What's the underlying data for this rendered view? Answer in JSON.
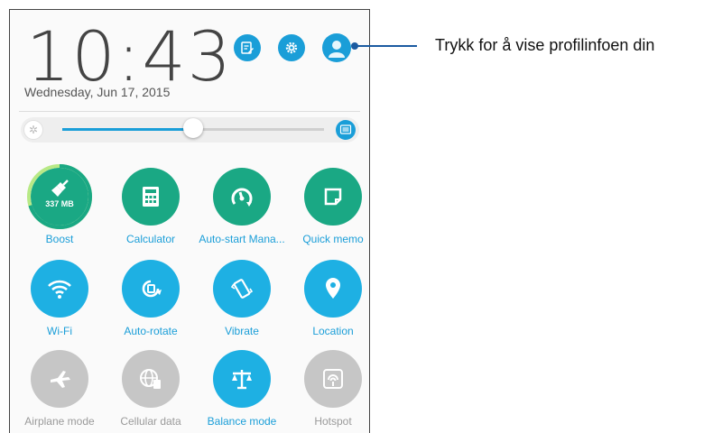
{
  "lockscreen": {
    "time": "10:43",
    "date": "Wednesday, Jun 17, 2015"
  },
  "header_icons": [
    {
      "name": "edit-icon"
    },
    {
      "name": "settings-icon"
    },
    {
      "name": "profile-icon"
    }
  ],
  "brightness": {
    "level_percent": 50,
    "auto_label": "AUTO"
  },
  "tiles": [
    {
      "label": "Boost",
      "sub": "337 MB",
      "state": "on",
      "color": "#1aa884"
    },
    {
      "label": "Calculator",
      "state": "on",
      "color": "#1aa884"
    },
    {
      "label": "Auto-start Mana...",
      "state": "on",
      "color": "#1aa884"
    },
    {
      "label": "Quick memo",
      "state": "on",
      "color": "#1aa884"
    },
    {
      "label": "Wi-Fi",
      "state": "on",
      "color": "#1eb0e3"
    },
    {
      "label": "Auto-rotate",
      "state": "on",
      "color": "#1eb0e3"
    },
    {
      "label": "Vibrate",
      "state": "on",
      "color": "#1eb0e3"
    },
    {
      "label": "Location",
      "state": "on",
      "color": "#1eb0e3"
    },
    {
      "label": "Airplane mode",
      "state": "off",
      "color": "#c6c6c6"
    },
    {
      "label": "Cellular data",
      "state": "off",
      "color": "#c6c6c6"
    },
    {
      "label": "Balance mode",
      "state": "on",
      "color": "#1eb0e3"
    },
    {
      "label": "Hotspot",
      "state": "off",
      "color": "#c6c6c6"
    }
  ],
  "callout": {
    "text": "Trykk for å vise profilinfoen din"
  },
  "colors": {
    "accent": "#1a9ed8",
    "green": "#1aa884",
    "blue": "#1eb0e3",
    "inactive": "#c6c6c6"
  }
}
